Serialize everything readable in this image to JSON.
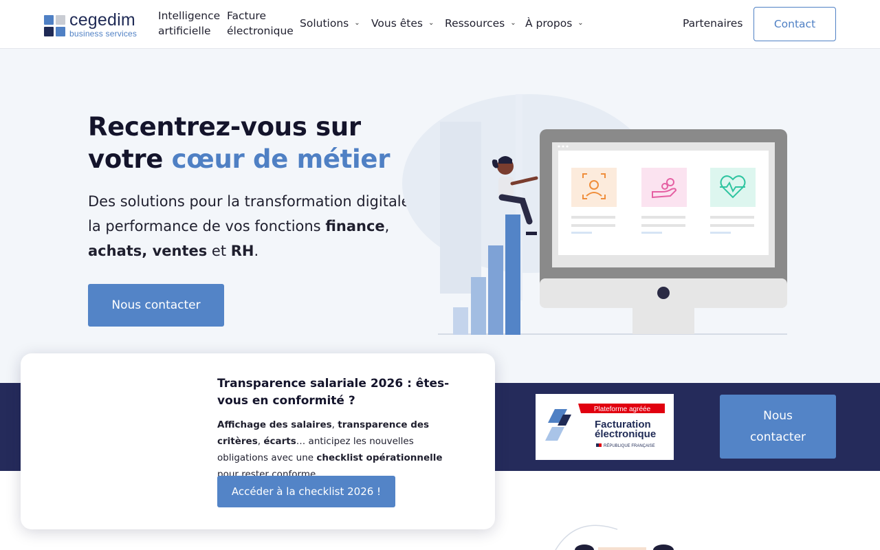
{
  "brand": {
    "name": "cegedim",
    "subtitle": "business services",
    "colors": {
      "primary": "#4f80c4",
      "dark": "#252b5b",
      "logo_dark": "#1f2a55"
    }
  },
  "nav": {
    "items": [
      {
        "line1": "Intelligence",
        "line2": "artificielle"
      },
      {
        "line1": "Facture",
        "line2": "électronique"
      }
    ],
    "dropdowns": [
      "Solutions",
      "Vous êtes",
      "Ressources",
      "À propos"
    ],
    "partners": "Partenaires",
    "contact": "Contact"
  },
  "hero": {
    "title_line1": "Recentrez-vous sur",
    "title_line2_plain": "votre ",
    "title_line2_accent": "cœur de métier",
    "desc_part1": "Des solutions pour la transformation digitale et la performance de vos fonctions ",
    "desc_bold1": "finance",
    "desc_part2": ", ",
    "desc_bold2": "achats, ventes",
    "desc_part3": " et ",
    "desc_bold3": "RH",
    "desc_part4": ".",
    "cta": "Nous contacter"
  },
  "band": {
    "badge_top": "Plateforme agréée",
    "badge_line1": "Facturation",
    "badge_line2": "électronique",
    "badge_footer": "RÉPUBLIQUE FRANÇAISE",
    "cta_line1": "Nous",
    "cta_line2": "contacter"
  },
  "popup": {
    "title": "Transparence salariale 2026 : êtes-vous en conformité ?",
    "b1": "Affichage des salaires",
    "t1": ", ",
    "b2": "transparence des critères",
    "t2": ", ",
    "b3": "écarts",
    "t3": "… anticipez les nouvelles obligations avec une ",
    "b4": "checklist opérationnelle",
    "t4": " pour rester conforme.",
    "cta": "Accéder à la checklist 2026 !"
  },
  "icons": {
    "logo": "cegedim-logo-squares",
    "chevron": "chevron-down-icon",
    "card1": "face-scan-icon",
    "card2": "hand-coins-icon",
    "card3": "heart-pulse-icon"
  }
}
